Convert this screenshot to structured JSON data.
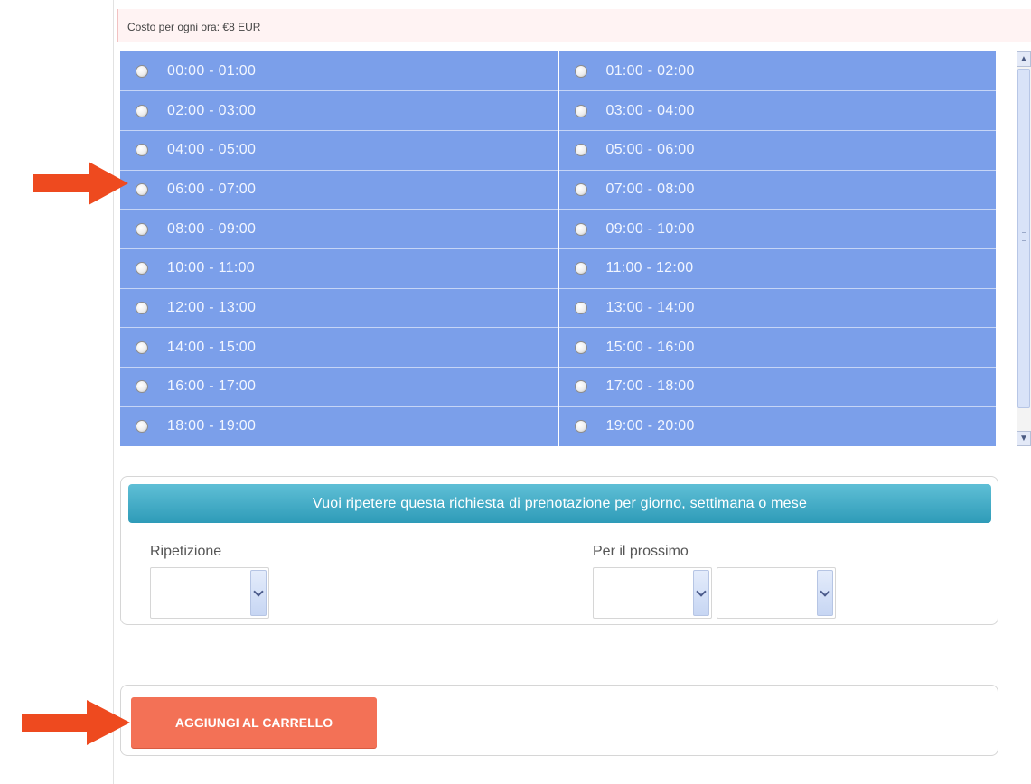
{
  "cost": {
    "text": "Costo per ogni ora: €8 EUR"
  },
  "slots": [
    {
      "left": "00:00  -  01:00",
      "right": "01:00  -  02:00"
    },
    {
      "left": "02:00  -  03:00",
      "right": "03:00  -  04:00"
    },
    {
      "left": "04:00  -  05:00",
      "right": "05:00  -  06:00"
    },
    {
      "left": "06:00  -  07:00",
      "right": "07:00  -  08:00"
    },
    {
      "left": "08:00  -  09:00",
      "right": "09:00  -  10:00"
    },
    {
      "left": "10:00  -  11:00",
      "right": "11:00  -  12:00"
    },
    {
      "left": "12:00  -  13:00",
      "right": "13:00  -  14:00"
    },
    {
      "left": "14:00  -  15:00",
      "right": "15:00  -  16:00"
    },
    {
      "left": "16:00  -  17:00",
      "right": "17:00  -  18:00"
    },
    {
      "left": "18:00  -  19:00",
      "right": "19:00  -  20:00"
    }
  ],
  "repeat": {
    "header": "Vuoi ripetere questa richiesta di prenotazione per giorno, settimana o mese",
    "repetition_label": "Ripetizione",
    "next_label": "Per il prossimo",
    "repetition_value": "",
    "next_number_value": "",
    "next_unit_value": ""
  },
  "cart": {
    "button_label": "AGGIUNGI AL CARRELLO"
  },
  "colors": {
    "slot_background": "#7b9fea",
    "header_teal": "#2e9bb8",
    "cart_button": "#f37156",
    "arrow": "#ee4a1f"
  }
}
